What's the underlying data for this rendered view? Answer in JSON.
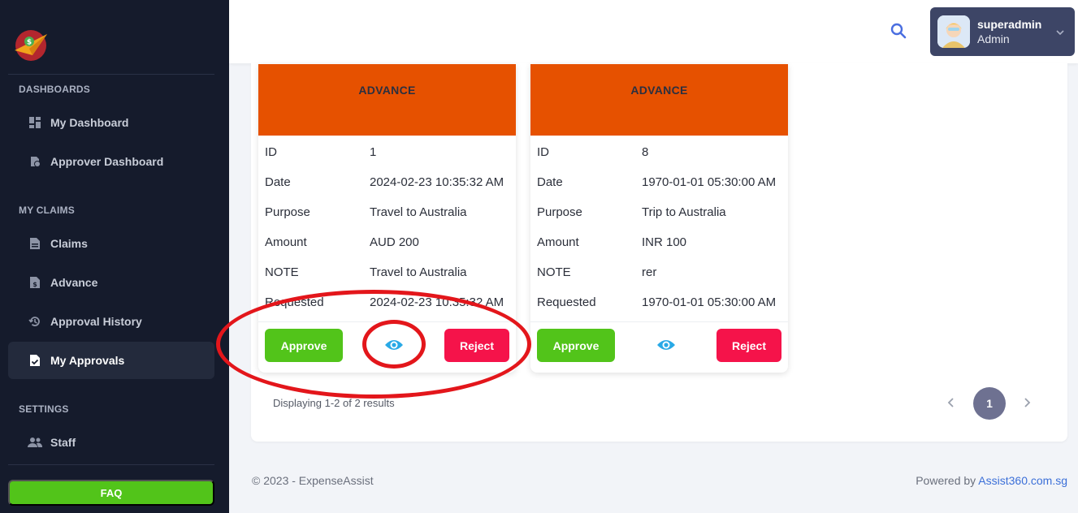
{
  "sidebar": {
    "sections": [
      {
        "title": "DASHBOARDS"
      },
      {
        "title": "MY CLAIMS"
      },
      {
        "title": "SETTINGS"
      }
    ],
    "items": [
      {
        "label": "My Dashboard",
        "icon": "dashboard-icon"
      },
      {
        "label": "Approver Dashboard",
        "icon": "approver-dashboard-icon"
      },
      {
        "label": "Claims",
        "icon": "document-icon"
      },
      {
        "label": "Advance",
        "icon": "dollar-document-icon"
      },
      {
        "label": "Approval History",
        "icon": "history-icon"
      },
      {
        "label": "My Approvals",
        "icon": "approval-document-icon",
        "active": true
      },
      {
        "label": "Staff",
        "icon": "people-icon"
      }
    ],
    "faq_label": "FAQ"
  },
  "header": {
    "user_name": "superadmin",
    "user_role": "Admin"
  },
  "cards": [
    {
      "type": "ADVANCE",
      "fields": [
        {
          "key": "ID",
          "value": "1"
        },
        {
          "key": "Date",
          "value": "2024-02-23 10:35:32 AM"
        },
        {
          "key": "Purpose",
          "value": "Travel to Australia"
        },
        {
          "key": "Amount",
          "value": "AUD 200"
        },
        {
          "key": "NOTE",
          "value": "Travel to Australia"
        },
        {
          "key": "Requested",
          "value": "2024-02-23 10:35:32 AM"
        }
      ],
      "approve_label": "Approve",
      "reject_label": "Reject"
    },
    {
      "type": "ADVANCE",
      "fields": [
        {
          "key": "ID",
          "value": "8"
        },
        {
          "key": "Date",
          "value": "1970-01-01 05:30:00 AM"
        },
        {
          "key": "Purpose",
          "value": "Trip to Australia"
        },
        {
          "key": "Amount",
          "value": "INR 100"
        },
        {
          "key": "NOTE",
          "value": "rer"
        },
        {
          "key": "Requested",
          "value": "1970-01-01 05:30:00 AM"
        }
      ],
      "approve_label": "Approve",
      "reject_label": "Reject"
    }
  ],
  "pagination": {
    "results_text": "Displaying 1-2 of 2 results",
    "current_page": "1"
  },
  "footer": {
    "copyright": "© 2023 - ExpenseAssist",
    "powered_prefix": "Powered by ",
    "powered_link": "Assist360.com.sg"
  },
  "colors": {
    "sidebar_bg": "#151b2c",
    "card_header": "#e65100",
    "approve": "#52c41a",
    "reject": "#f5134a",
    "eye": "#29a9e6",
    "annotation": "#e3161b"
  }
}
